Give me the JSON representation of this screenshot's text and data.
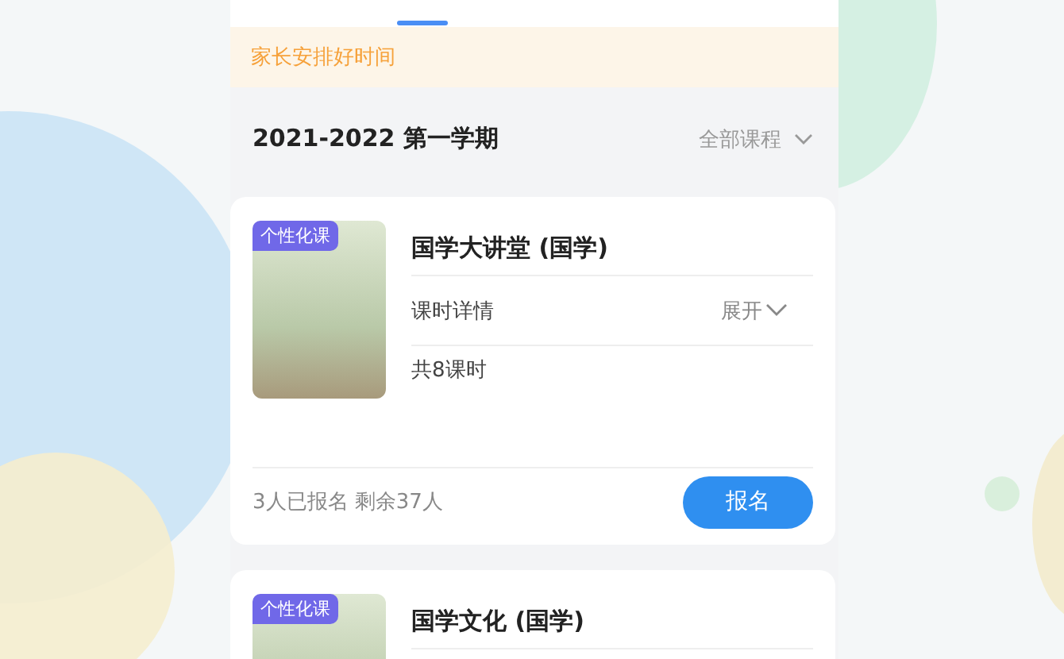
{
  "notice": "家长安排好时间",
  "semester": {
    "title": "2021-2022 第一学期",
    "filter": "全部课程"
  },
  "courses": [
    {
      "badge": "个性化课",
      "title": "国学大讲堂 (国学)",
      "detail_label": "课时详情",
      "expand": "展开",
      "lessons": "共8课时",
      "enrolled": "3人已报名 剩余37人",
      "action": "报名"
    },
    {
      "badge": "个性化课",
      "title": "国学文化 (国学)"
    }
  ]
}
